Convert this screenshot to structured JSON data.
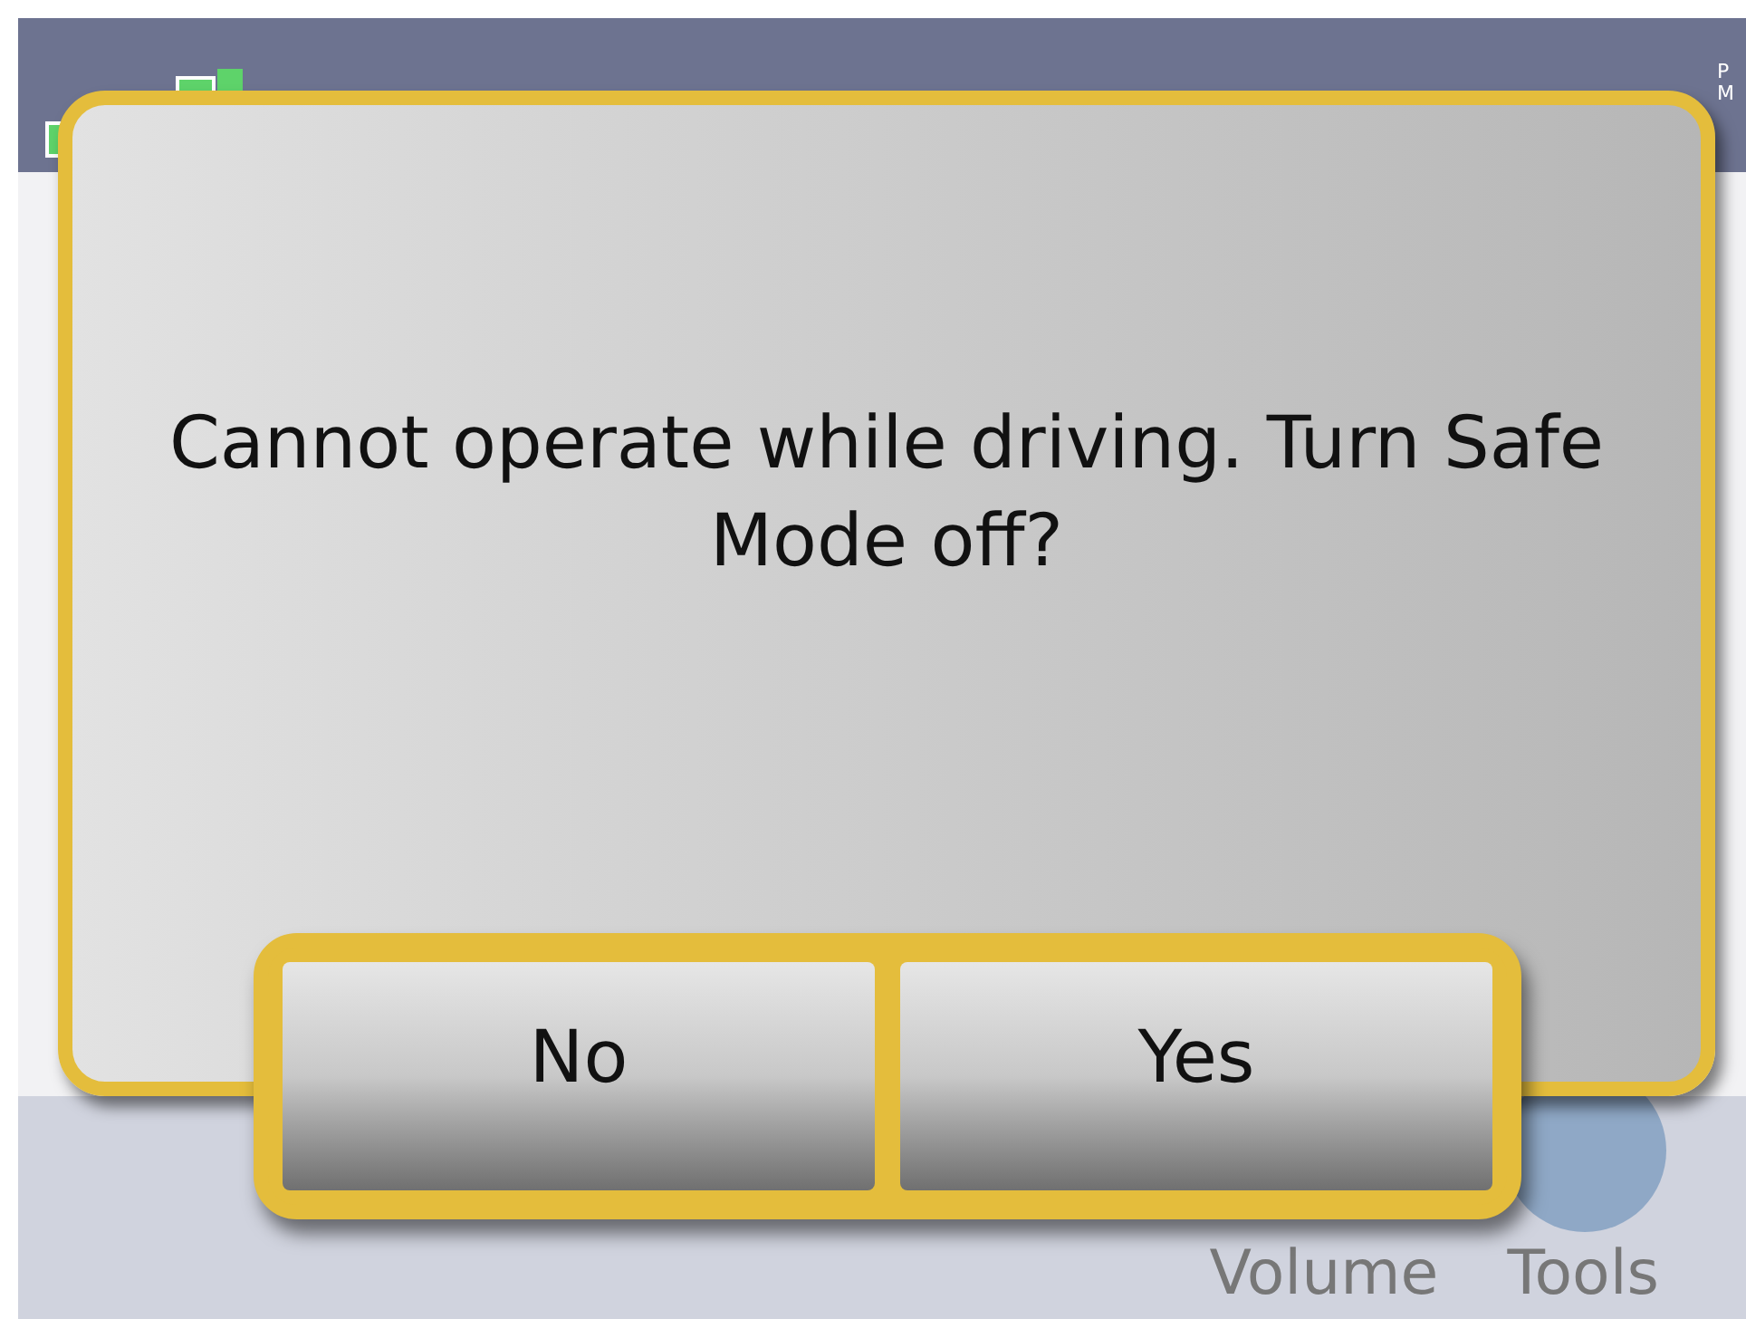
{
  "status_bar": {
    "am_pm": "PM"
  },
  "bottom_menu": [
    {
      "label": "Volume"
    },
    {
      "label": "Tools"
    }
  ],
  "dialog": {
    "message": "Cannot operate while driving. Turn Safe Mode off?",
    "buttons": [
      {
        "label": "No"
      },
      {
        "label": "Yes"
      }
    ]
  }
}
